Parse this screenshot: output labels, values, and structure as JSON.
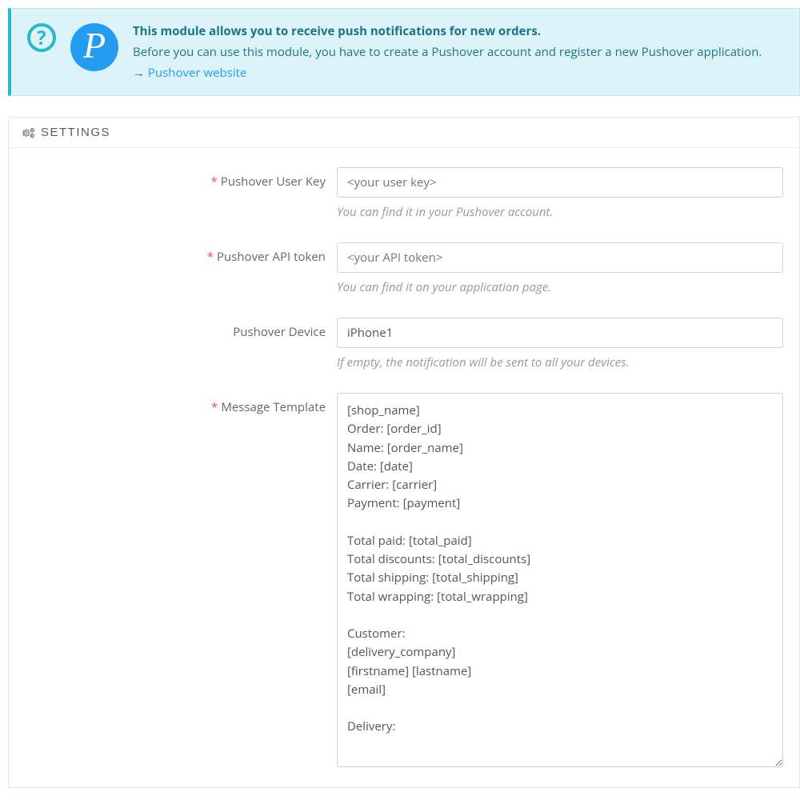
{
  "alert": {
    "title": "This module allows you to receive push notifications for new orders.",
    "desc": "Before you can use this module, you have to create a Pushover account and register a new Pushover application.",
    "arrow": "→ ",
    "link": "Pushover website"
  },
  "panel": {
    "heading": "SETTINGS"
  },
  "fields": {
    "userkey": {
      "label": "Pushover User Key",
      "placeholder": "<your user key>",
      "help": "You can find it in your Pushover account."
    },
    "apitoken": {
      "label": "Pushover API token",
      "placeholder": "<your API token>",
      "help": "You can find it on your application page."
    },
    "device": {
      "label": "Pushover Device",
      "value": "iPhone1",
      "help": "If empty, the notification will be sent to all your devices."
    },
    "template": {
      "label": "Message Template",
      "value": "[shop_name]\nOrder: [order_id]\nName: [order_name]\nDate: [date]\nCarrier: [carrier]\nPayment: [payment]\n\nTotal paid: [total_paid]\nTotal discounts: [total_discounts]\nTotal shipping: [total_shipping]\nTotal wrapping: [total_wrapping]\n\nCustomer:\n[delivery_company]\n[firstname] [lastname]\n[email]\n\nDelivery:"
    }
  }
}
